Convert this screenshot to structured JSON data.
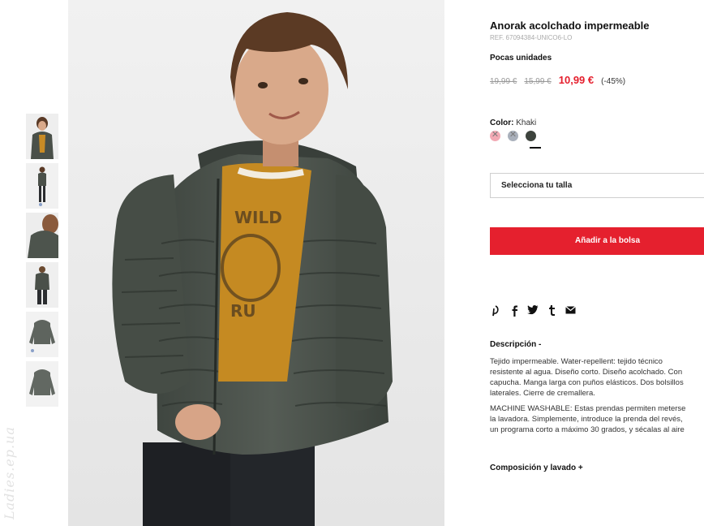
{
  "watermark": "Ladies.ep.ua",
  "gallery": {
    "thumbnails": [
      {
        "view": "front"
      },
      {
        "view": "full-body"
      },
      {
        "view": "hood-side"
      },
      {
        "view": "back"
      },
      {
        "view": "product-front"
      },
      {
        "view": "product-back"
      }
    ]
  },
  "product": {
    "title": "Anorak acolchado impermeable",
    "ref": "REF. 67094384-UNICO6-LO",
    "stock_notice": "Pocas unidades",
    "prices": {
      "original": "19,99 €",
      "previous": "15,99 €",
      "current": "10,99 €",
      "discount": "(-45%)"
    },
    "color": {
      "label": "Color:",
      "selected": "Khaki",
      "swatches": [
        {
          "name": "pink",
          "hex": "#f2a9b4",
          "available": false
        },
        {
          "name": "grey",
          "hex": "#a9b0bb",
          "available": false
        },
        {
          "name": "khaki",
          "hex": "#3d433d",
          "available": true,
          "selected": true
        }
      ]
    },
    "size_select": {
      "placeholder": "Selecciona tu talla"
    },
    "add_to_bag": "Añadir a la bolsa",
    "social": [
      {
        "icon": "pinterest-icon",
        "glyph": "P"
      },
      {
        "icon": "facebook-icon",
        "glyph": "f"
      },
      {
        "icon": "twitter-icon",
        "glyph": "✓"
      },
      {
        "icon": "tumblr-icon",
        "glyph": "t"
      },
      {
        "icon": "email-icon",
        "glyph": "✉"
      }
    ],
    "description": {
      "toggle": "Descripción  -",
      "lines_1": [
        "Tejido impermeable. Water-repellent: tejido técnico",
        "resistente al agua. Diseño corto. Diseño acolchado. Con",
        "capucha. Manga larga con puños elásticos. Dos bolsillos",
        "laterales. Cierre de cremallera."
      ],
      "lines_2": [
        "MACHINE WASHABLE: Estas prendas permiten meterse",
        "la lavadora. Simplemente, introduce la prenda del revés,",
        "un programa corto a máximo 30 grados, y sécalas al aire"
      ]
    },
    "composition_toggle": "Composición y lavado  +"
  }
}
